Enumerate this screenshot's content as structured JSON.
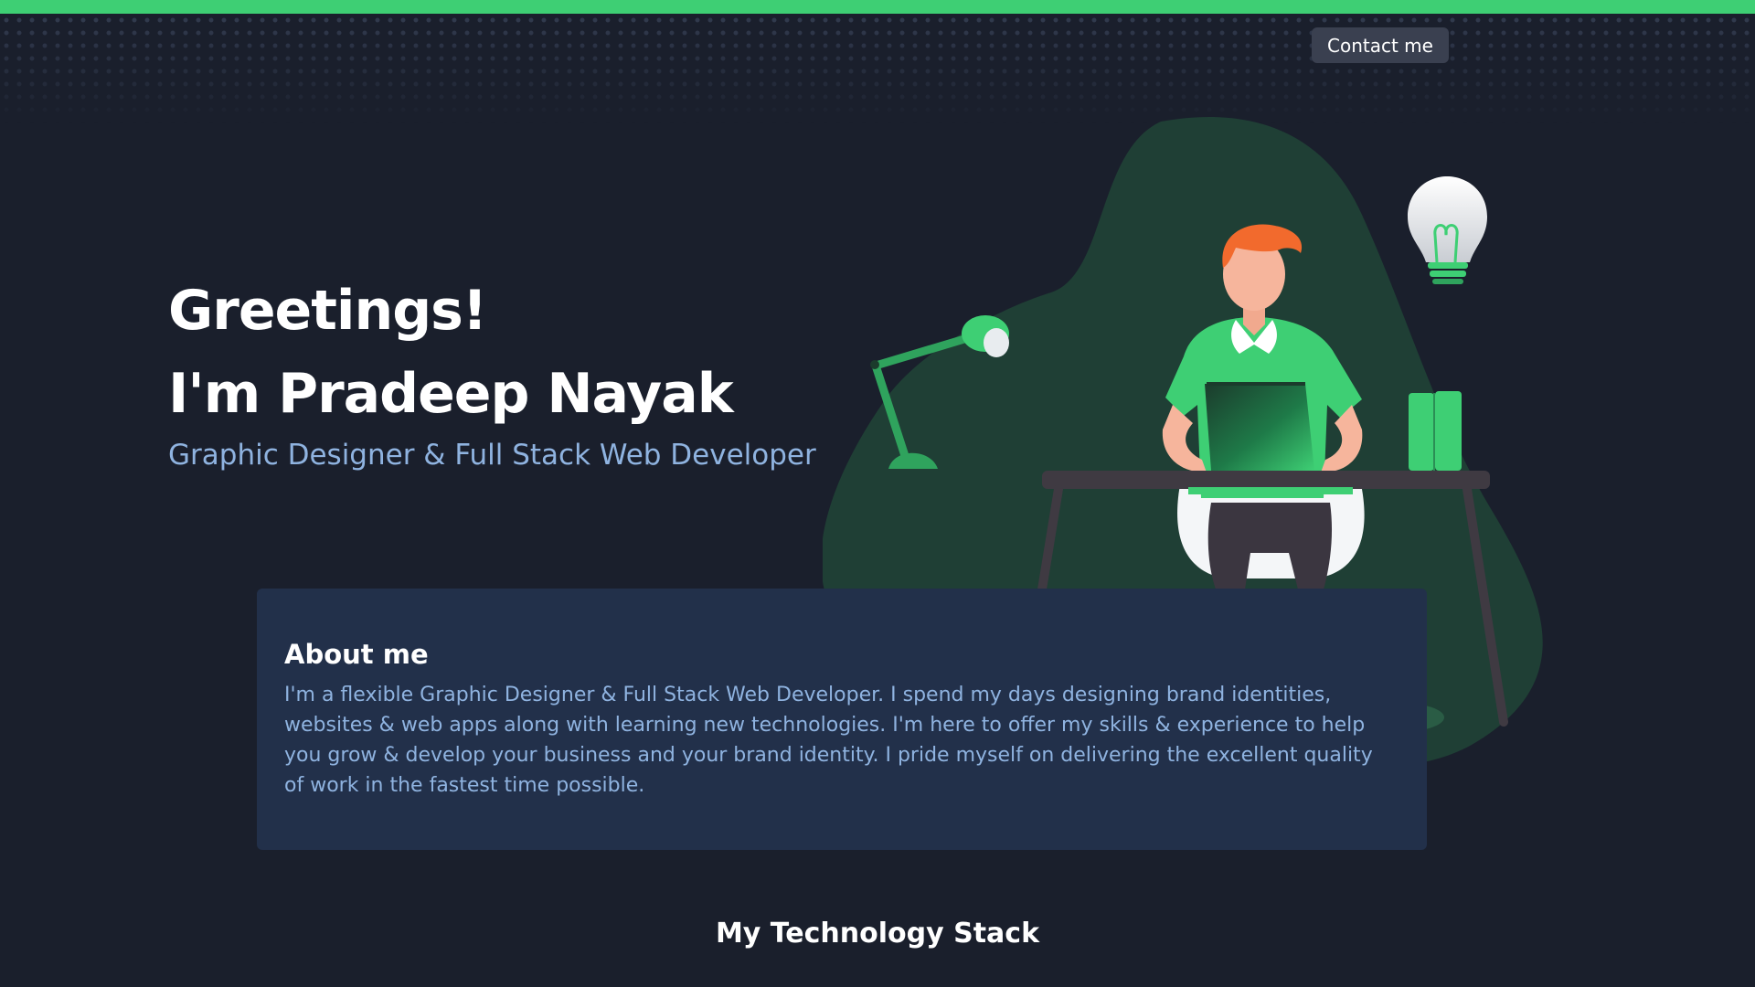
{
  "header": {
    "contact_label": "Contact me"
  },
  "hero": {
    "greeting": "Greetings!",
    "name": "I'm Pradeep Nayak",
    "role": "Graphic Designer & Full Stack Web Developer"
  },
  "about": {
    "title": "About me",
    "text": "I'm a flexible Graphic Designer & Full Stack Web Developer. I spend my days designing brand identities, websites & web apps along with learning new technologies. I'm here to offer my skills & experience to help you grow & develop your business and your brand identity. I pride myself on delivering the excellent quality of work in the fastest time possible."
  },
  "tech_stack": {
    "title": "My Technology Stack"
  },
  "colors": {
    "background": "#1a1f2c",
    "accent": "#3ecf74",
    "card": "#22304a",
    "subtitle": "#8fb3e0",
    "blob": "#1f3f35"
  },
  "icons": {
    "illustration": "developer-at-desk-illustration"
  }
}
